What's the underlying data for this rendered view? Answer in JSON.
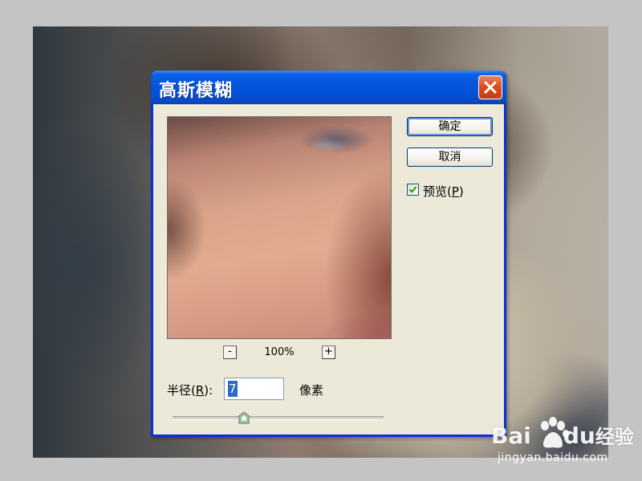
{
  "dialog": {
    "title": "高斯模糊",
    "ok_label": "确定",
    "cancel_label": "取消",
    "preview_checkbox": {
      "label": "预览(",
      "mnemonic": "P",
      "label_suffix": ")",
      "checked": true
    },
    "zoom": {
      "minus_label": "-",
      "plus_label": "+",
      "level": "100%"
    },
    "radius": {
      "label": "半径(",
      "mnemonic": "R",
      "label_suffix": "):",
      "value": "7",
      "unit": "像素",
      "slider_fraction": 0.34
    }
  },
  "watermark": {
    "logo_text": "Bai",
    "logo_text2": "du",
    "logo_text3": "经验",
    "url": "jingyan.baidu.com"
  },
  "colors": {
    "titlebar": "#0556dc",
    "dialog_bg": "#ece9d8",
    "close_button": "#dc4f1f",
    "selection": "#316ac5"
  }
}
